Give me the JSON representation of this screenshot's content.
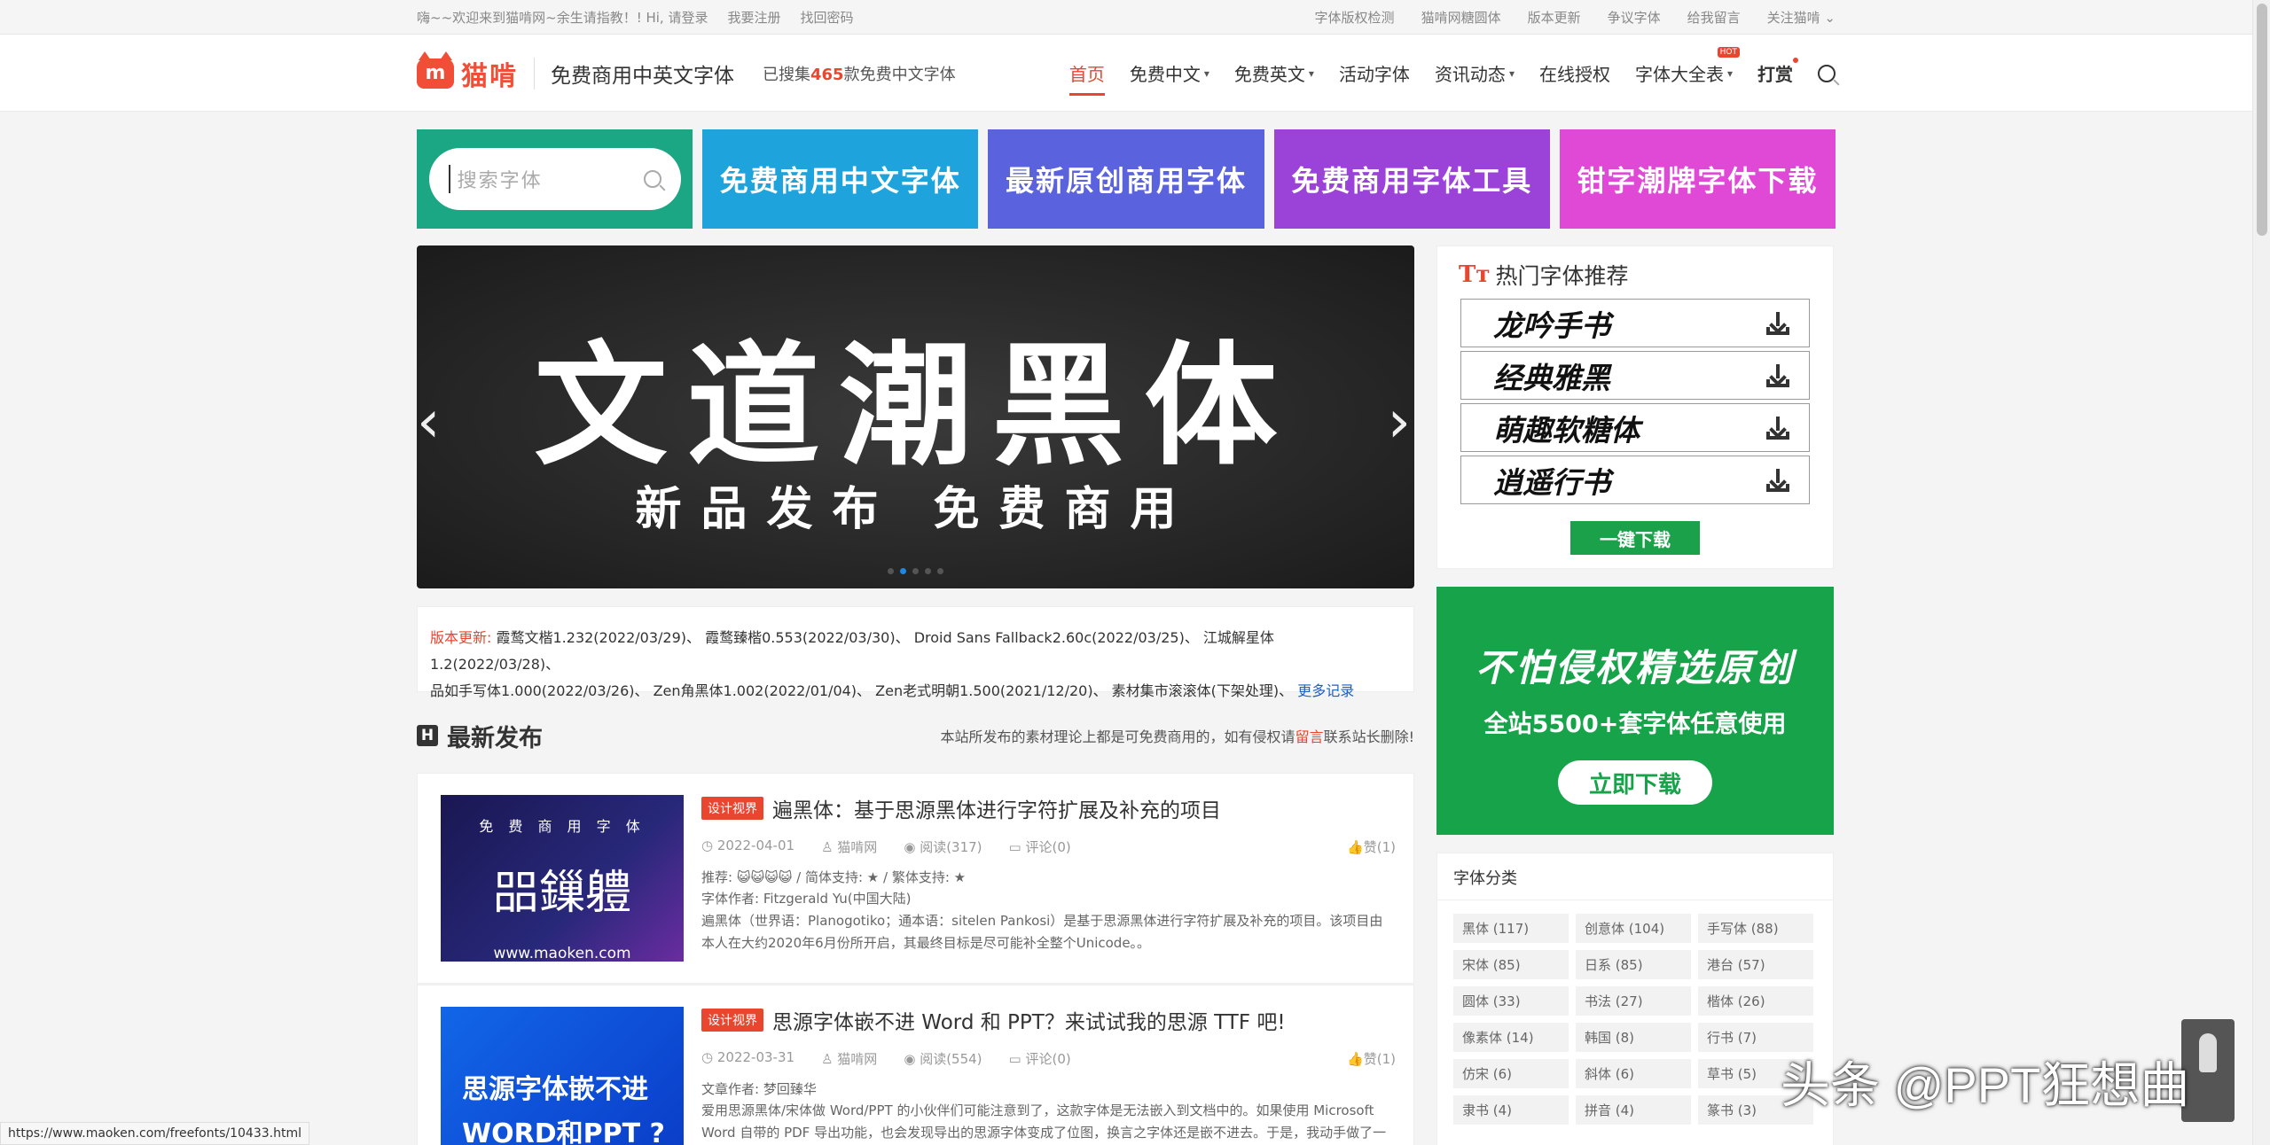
{
  "topbar": {
    "greeting": "嗨~~欢迎来到猫啃网~余生请指教！! Hi, 请登录",
    "register": "我要注册",
    "recover": "找回密码",
    "links": [
      "字体版权检测",
      "猫啃网糖圆体",
      "版本更新",
      "争议字体",
      "给我留言",
      "关注猫啃"
    ]
  },
  "header": {
    "logo_text": "猫啃",
    "logo_letter": "m",
    "slogan": "免费商用中英文字体",
    "collect_prefix": "已搜集",
    "collect_count": "465",
    "collect_suffix": "款免费中文字体",
    "nav": [
      {
        "label": "首页"
      },
      {
        "label": "免费中文"
      },
      {
        "label": "免费英文"
      },
      {
        "label": "活动字体"
      },
      {
        "label": "资讯动态"
      },
      {
        "label": "在线授权"
      },
      {
        "label": "字体大全表"
      },
      {
        "label": "打赏"
      }
    ],
    "hot_badge": "HOT"
  },
  "tiles": {
    "search_placeholder": "搜索字体",
    "items": [
      "免费商用中文字体",
      "最新原创商用字体",
      "免费商用字体工具",
      "钳字潮牌字体下载"
    ],
    "colors": [
      "#1ba784",
      "#1fa3dc",
      "#5b62dd",
      "#9b43d8",
      "#e048d6"
    ]
  },
  "slider": {
    "headline": "文道潮黑体",
    "subline": "新品发布 免费商用",
    "arrow_left": "‹",
    "arrow_right": "›"
  },
  "updates": {
    "label": "版本更新:",
    "line1": "霞鹜文楷1.232(2022/03/29)、 霞鹜臻楷0.553(2022/03/30)、 Droid Sans Fallback2.60c(2022/03/25)、 江城解星体1.2(2022/03/28)、",
    "line2": "品如手写体1.000(2022/03/26)、 Zen角黑体1.002(2022/01/04)、 Zen老式明朝1.500(2021/12/20)、 素材集市滚滚体(下架处理)、",
    "more": "更多记录"
  },
  "latest": {
    "title": "最新发布",
    "h_icon": "H",
    "note_prefix": "本站所发布的素材理论上都是可免费商用的，如有侵权请",
    "note_link": "留言",
    "note_suffix": "联系站长删除!"
  },
  "posts": [
    {
      "tag": "设计视界",
      "title": "遍黑体：基于思源黑体进行字符扩展及补充的项目",
      "date": "2022-04-01",
      "author": "猫啃网",
      "reads": "阅读(317)",
      "comments": "评论(0)",
      "likes": "赞(1)",
      "line1": "推荐: 😺😺😺😺 / 简体支持: ★ / 繁体支持: ★",
      "line2": "字体作者: Fitzgerald Yu(中国大陆)",
      "desc": "遍黑体（世界语：Planogotiko；通本语：sitelen Pankosi）是基于思源黑体进行字符扩展及补充的项目。该项目由本人在大约2020年6月份所开启，其最终目标是尽可能补全整个Unicode。。",
      "thumb_top": "免 费 商 用 字 体",
      "thumb_main": "㗊鏁軆",
      "thumb_url": "www.maoken.com"
    },
    {
      "tag": "设计视界",
      "title": "思源字体嵌不进 Word 和 PPT？来试试我的思源 TTF 吧!",
      "date": "2022-03-31",
      "author": "猫啃网",
      "reads": "阅读(554)",
      "comments": "评论(0)",
      "likes": "赞(1)",
      "line1": "文章作者: 梦回臻华",
      "desc": "爱用思源黑体/宋体做 Word/PPT 的小伙伴们可能注意到了，这款字体是无法嵌入到文档中的。如果使用 Microsoft Word 自带的 PDF 导出功能，也会发现导出的思源字体变成了位图，换言之字体还是嵌不进去。于是，我动手做了一",
      "thumb_l1": "思源字体嵌不进",
      "thumb_l2": "WORD和PPT ?"
    }
  ],
  "sidebar": {
    "hot_title": "热门字体推荐",
    "tt_icon": "Tт",
    "hot_fonts": [
      "龙吟手书",
      "经典雅黑",
      "萌趣软糖体",
      "逍遥行书"
    ],
    "onekey": "一键下载",
    "ad_line1": "不怕侵权精选原创",
    "ad_line2": "全站5500+套字体任意使用",
    "ad_button": "立即下载",
    "cat_title": "字体分类",
    "categories": [
      "黑体 (117)",
      "创意体 (104)",
      "手写体 (88)",
      "宋体 (85)",
      "日系 (85)",
      "港台 (57)",
      "圆体 (33)",
      "书法 (27)",
      "楷体 (26)",
      "像素体 (14)",
      "韩国 (8)",
      "行书 (7)",
      "仿宋 (6)",
      "斜体 (6)",
      "草书 (5)",
      "隶书 (4)",
      "拼音 (4)",
      "篆书 (3)"
    ]
  },
  "status_url": "https://www.maoken.com/freefonts/10433.html",
  "watermark": "头条 @PPT狂想曲"
}
